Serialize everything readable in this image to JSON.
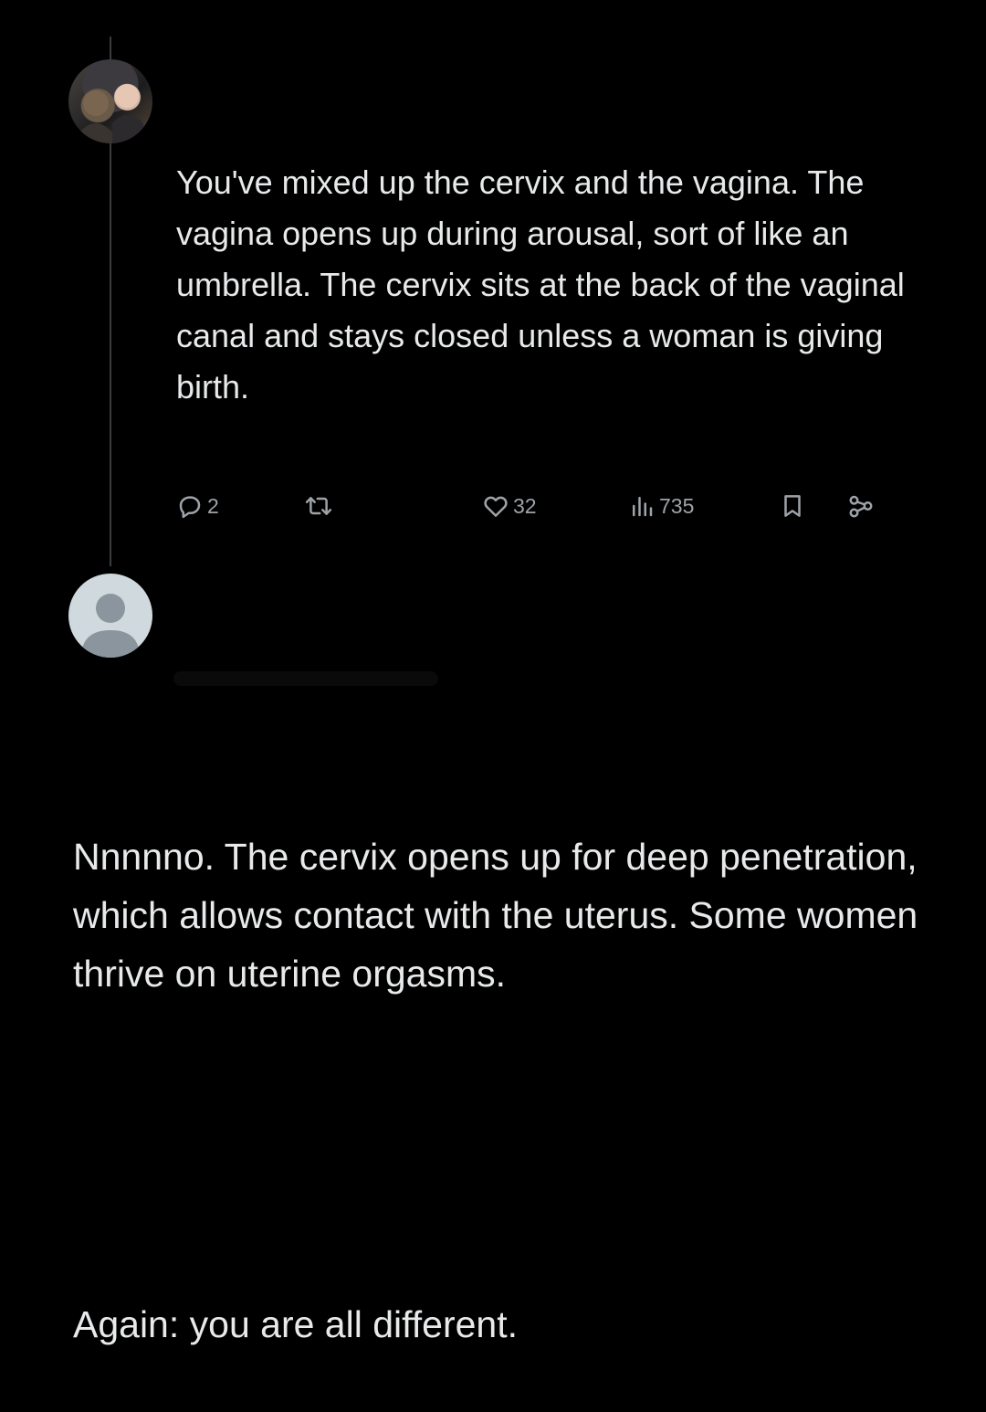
{
  "reply": {
    "text": "You've mixed up the cervix and the vagina. The vagina opens up during arousal, sort of like an umbrella. The cervix sits at the back of the vaginal canal and stays closed unless a woman is giving birth.",
    "actions": {
      "reply_count": "2",
      "like_count": "32",
      "view_count": "735"
    },
    "icons": {
      "reply": "speech-bubble-icon",
      "retweet": "retweet-icon",
      "like": "heart-icon",
      "views": "bar-chart-icon",
      "bookmark": "bookmark-icon",
      "share": "share-icon"
    }
  },
  "main_post": {
    "paragraphs": [
      "Nnnnno. The cervix opens up for deep penetration, which allows contact with the uterus. Some women thrive on uterine orgasms.",
      "Again: you are all different."
    ]
  },
  "colors": {
    "background": "#000000",
    "text": "#e7e9ea",
    "icon": "#9ea3a8",
    "thread_line": "#3a3d40",
    "default_avatar": "#cfd9de"
  }
}
